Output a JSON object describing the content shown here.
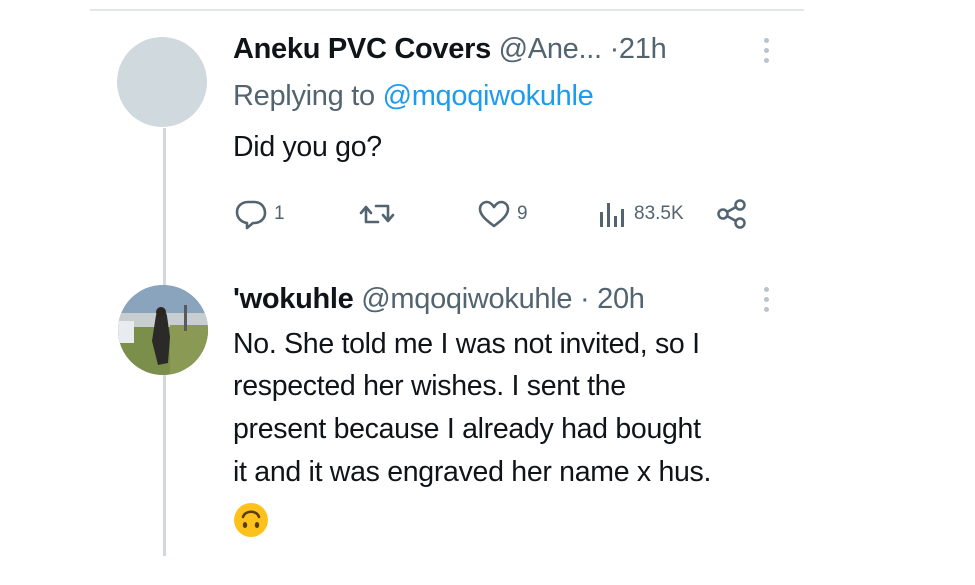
{
  "tweet1": {
    "display_name": "Aneku PVC Covers",
    "handle": "@Ane...",
    "separator": "·",
    "time": "21h",
    "replying_prefix": "Replying to",
    "replying_handle": "@mqoqiwokuhle",
    "text": "Did you go?",
    "actions": {
      "replies": "1",
      "likes": "9",
      "views": "83.5K"
    }
  },
  "tweet2": {
    "display_name": "'wokuhle",
    "handle": "@mqoqiwokuhle",
    "separator": "·",
    "time": "20h",
    "lines": [
      "No. She told me I was not invited, so I",
      "respected her wishes. I sent the",
      "present because I already had bought",
      "it and it was engraved her name x hus."
    ],
    "emoji": "upside-down-face-icon"
  },
  "colors": {
    "text": "#0f1419",
    "muted": "#536471",
    "link": "#1d9bf0",
    "thread_line": "#cfd9de"
  }
}
